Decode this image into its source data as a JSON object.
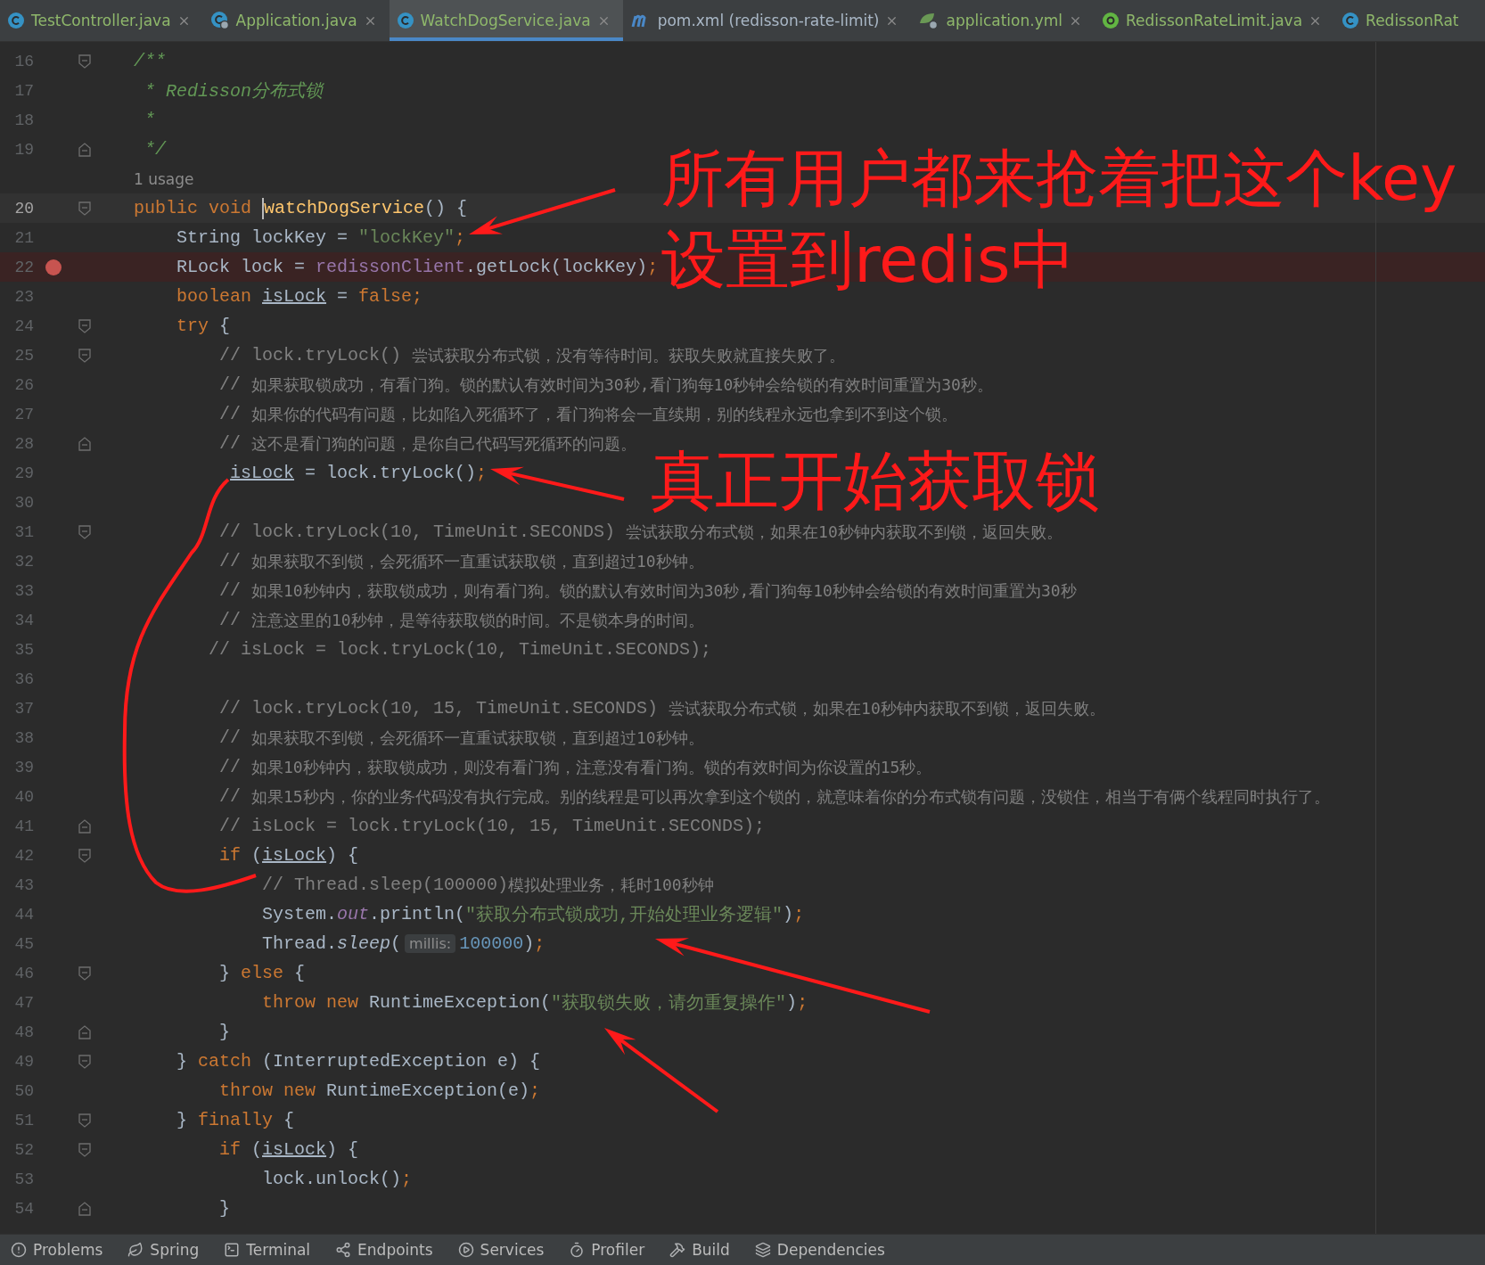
{
  "tabs": [
    {
      "label": "TestController.java",
      "selected": false,
      "color": "#8fb86b",
      "closable": true
    },
    {
      "label": "Application.java",
      "selected": false,
      "color": "#8fb86b",
      "closable": true
    },
    {
      "label": "WatchDogService.java",
      "selected": true,
      "color": "#8fb86b",
      "closable": true
    },
    {
      "label": "pom.xml (redisson-rate-limit)",
      "selected": false,
      "color": "#a9b7c6",
      "closable": true
    },
    {
      "label": "application.yml",
      "selected": false,
      "color": "#8fb86b",
      "closable": true
    },
    {
      "label": "RedissonRateLimit.java",
      "selected": false,
      "color": "#8fb86b",
      "closable": true
    },
    {
      "label": "RedissonRat",
      "selected": false,
      "color": "#8fb86b",
      "closable": false
    }
  ],
  "editor": {
    "lines": [
      {
        "kind": "code",
        "number": "16",
        "fold_start": true,
        "tokens": [
          {
            "kind": "doc",
            "text": "/**"
          }
        ]
      },
      {
        "kind": "code",
        "number": "17",
        "tokens": [
          {
            "kind": "doc",
            "text": " * Redisson分布式锁"
          }
        ]
      },
      {
        "kind": "code",
        "number": "18",
        "tokens": [
          {
            "kind": "doc",
            "text": " *"
          }
        ]
      },
      {
        "kind": "code",
        "number": "19",
        "fold_end": true,
        "tokens": [
          {
            "kind": "doc",
            "text": " */"
          }
        ]
      },
      {
        "kind": "usage",
        "text": "1 usage"
      },
      {
        "kind": "code",
        "number": "20",
        "fold_start": true,
        "current": true,
        "tokens": [
          {
            "kind": "keyword",
            "text": "public void "
          },
          {
            "kind": "method",
            "text": "watchDogService",
            "caret": true
          },
          {
            "kind": "plain",
            "text": "() {"
          }
        ]
      },
      {
        "kind": "code",
        "number": "21",
        "tokens": [
          {
            "kind": "plain",
            "text": "    String lockKey = "
          },
          {
            "kind": "string",
            "text": "\"lockKey\""
          },
          {
            "kind": "keyword",
            "text": ";"
          }
        ]
      },
      {
        "kind": "code",
        "number": "22",
        "breakpoint": true,
        "tokens": [
          {
            "kind": "plain",
            "text": "    RLock lock = "
          },
          {
            "kind": "field",
            "text": "redissonClient"
          },
          {
            "kind": "plain",
            "text": ".getLock(lockKey)"
          },
          {
            "kind": "keyword",
            "text": ";"
          }
        ]
      },
      {
        "kind": "code",
        "number": "23",
        "tokens": [
          {
            "kind": "keyword",
            "text": "    boolean "
          },
          {
            "kind": "var",
            "text": "isLock"
          },
          {
            "kind": "plain",
            "text": " = "
          },
          {
            "kind": "keyword",
            "text": "false;"
          }
        ]
      },
      {
        "kind": "code",
        "number": "24",
        "fold_start": true,
        "tokens": [
          {
            "kind": "keyword",
            "text": "    try "
          },
          {
            "kind": "plain",
            "text": "{"
          }
        ]
      },
      {
        "kind": "code",
        "number": "25",
        "fold_start": true,
        "tokens": [
          {
            "kind": "comment",
            "text": "        // lock.tryLock() "
          },
          {
            "kind": "note",
            "text": "尝试获取分布式锁，没有等待时间。获取失败就直接失败了。"
          }
        ]
      },
      {
        "kind": "code",
        "number": "26",
        "tokens": [
          {
            "kind": "comment",
            "text": "        // "
          },
          {
            "kind": "note",
            "text": "如果获取锁成功，有看门狗。锁的默认有效时间为30秒,看门狗每10秒钟会给锁的有效时间重置为30秒。"
          }
        ]
      },
      {
        "kind": "code",
        "number": "27",
        "tokens": [
          {
            "kind": "comment",
            "text": "        // "
          },
          {
            "kind": "note",
            "text": "如果你的代码有问题，比如陷入死循环了，看门狗将会一直续期，别的线程永远也拿到不到这个锁。"
          }
        ]
      },
      {
        "kind": "code",
        "number": "28",
        "fold_end": true,
        "tokens": [
          {
            "kind": "comment",
            "text": "        // "
          },
          {
            "kind": "note",
            "text": "这不是看门狗的问题，是你自己代码写死循环的问题。"
          }
        ]
      },
      {
        "kind": "code",
        "number": "29",
        "tokens": [
          {
            "kind": "var",
            "text": "         isLock"
          },
          {
            "kind": "plain",
            "text": " = lock.tryLock()"
          },
          {
            "kind": "keyword",
            "text": ";"
          }
        ]
      },
      {
        "kind": "code",
        "number": "30"
      },
      {
        "kind": "code",
        "number": "31",
        "fold_start": true,
        "tokens": [
          {
            "kind": "comment",
            "text": "        // lock.tryLock(10, TimeUnit.SECONDS) "
          },
          {
            "kind": "note",
            "text": "尝试获取分布式锁，如果在10秒钟内获取不到锁，返回失败。"
          }
        ]
      },
      {
        "kind": "code",
        "number": "32",
        "tokens": [
          {
            "kind": "comment",
            "text": "        // "
          },
          {
            "kind": "note",
            "text": "如果获取不到锁，会死循环一直重试获取锁，直到超过10秒钟。"
          }
        ]
      },
      {
        "kind": "code",
        "number": "33",
        "tokens": [
          {
            "kind": "comment",
            "text": "        // "
          },
          {
            "kind": "note",
            "text": "如果10秒钟内，获取锁成功，则有看门狗。锁的默认有效时间为30秒,看门狗每10秒钟会给锁的有效时间重置为30秒"
          }
        ]
      },
      {
        "kind": "code",
        "number": "34",
        "tokens": [
          {
            "kind": "comment",
            "text": "        // "
          },
          {
            "kind": "note",
            "text": "注意这里的10秒钟，是等待获取锁的时间。不是锁本身的时间。"
          }
        ]
      },
      {
        "kind": "code",
        "number": "35",
        "tokens": [
          {
            "kind": "comment",
            "text": "       // isLock = lock.tryLock(10, TimeUnit.SECONDS);"
          }
        ]
      },
      {
        "kind": "code",
        "number": "36"
      },
      {
        "kind": "code",
        "number": "37",
        "tokens": [
          {
            "kind": "comment",
            "text": "        // lock.tryLock(10, 15, TimeUnit.SECONDS) "
          },
          {
            "kind": "note",
            "text": "尝试获取分布式锁，如果在10秒钟内获取不到锁，返回失败。"
          }
        ]
      },
      {
        "kind": "code",
        "number": "38",
        "tokens": [
          {
            "kind": "comment",
            "text": "        // "
          },
          {
            "kind": "note",
            "text": "如果获取不到锁，会死循环一直重试获取锁，直到超过10秒钟。"
          }
        ]
      },
      {
        "kind": "code",
        "number": "39",
        "tokens": [
          {
            "kind": "comment",
            "text": "        // "
          },
          {
            "kind": "note",
            "text": "如果10秒钟内，获取锁成功，则没有看门狗，注意没有看门狗。锁的有效时间为你设置的15秒。"
          }
        ]
      },
      {
        "kind": "code",
        "number": "40",
        "tokens": [
          {
            "kind": "comment",
            "text": "        // "
          },
          {
            "kind": "note",
            "text": "如果15秒内，你的业务代码没有执行完成。别的线程是可以再次拿到这个锁的，就意味着你的分布式锁有问题，没锁住，相当于有俩个线程同时执行了。"
          }
        ]
      },
      {
        "kind": "code",
        "number": "41",
        "fold_end": true,
        "tokens": [
          {
            "kind": "comment",
            "text": "        // isLock = lock.tryLock(10, 15, TimeUnit.SECONDS);"
          }
        ]
      },
      {
        "kind": "code",
        "number": "42",
        "fold_start": true,
        "tokens": [
          {
            "kind": "keyword",
            "text": "        if "
          },
          {
            "kind": "plain",
            "text": "("
          },
          {
            "kind": "var",
            "text": "isLock"
          },
          {
            "kind": "plain",
            "text": ") {"
          }
        ]
      },
      {
        "kind": "code",
        "number": "43",
        "tokens": [
          {
            "kind": "comment",
            "text": "            // Thread.sleep(100000)"
          },
          {
            "kind": "note",
            "text": "模拟处理业务，耗时100秒钟"
          }
        ]
      },
      {
        "kind": "code",
        "number": "44",
        "tokens": [
          {
            "kind": "plain",
            "text": "            System."
          },
          {
            "kind": "static",
            "text": "out"
          },
          {
            "kind": "plain",
            "text": ".println("
          },
          {
            "kind": "string",
            "text": "\"获取分布式锁成功,开始处理业务逻辑\""
          },
          {
            "kind": "plain",
            "text": ")"
          },
          {
            "kind": "keyword",
            "text": ";"
          }
        ]
      },
      {
        "kind": "code",
        "number": "45",
        "tokens": [
          {
            "kind": "plain",
            "text": "            Thread."
          },
          {
            "kind": "italic",
            "text": "sleep"
          },
          {
            "kind": "plain",
            "text": "("
          },
          {
            "kind": "hint",
            "text": "millis:"
          },
          {
            "kind": "number",
            "text": "100000"
          },
          {
            "kind": "plain",
            "text": ")"
          },
          {
            "kind": "keyword",
            "text": ";"
          }
        ]
      },
      {
        "kind": "code",
        "number": "46",
        "fold_start": true,
        "tokens": [
          {
            "kind": "plain",
            "text": "        } "
          },
          {
            "kind": "keyword",
            "text": "else "
          },
          {
            "kind": "plain",
            "text": "{"
          }
        ]
      },
      {
        "kind": "code",
        "number": "47",
        "tokens": [
          {
            "kind": "keyword",
            "text": "            throw new "
          },
          {
            "kind": "plain",
            "text": "RuntimeException("
          },
          {
            "kind": "string",
            "text": "\"获取锁失败，请勿重复操作\""
          },
          {
            "kind": "plain",
            "text": ")"
          },
          {
            "kind": "keyword",
            "text": ";"
          }
        ]
      },
      {
        "kind": "code",
        "number": "48",
        "fold_end": true,
        "tokens": [
          {
            "kind": "plain",
            "text": "        }"
          }
        ]
      },
      {
        "kind": "code",
        "number": "49",
        "fold_start": true,
        "tokens": [
          {
            "kind": "plain",
            "text": "    } "
          },
          {
            "kind": "keyword",
            "text": "catch "
          },
          {
            "kind": "plain",
            "text": "(InterruptedException e) {"
          }
        ]
      },
      {
        "kind": "code",
        "number": "50",
        "tokens": [
          {
            "kind": "keyword",
            "text": "        throw new "
          },
          {
            "kind": "plain",
            "text": "RuntimeException(e)"
          },
          {
            "kind": "keyword",
            "text": ";"
          }
        ]
      },
      {
        "kind": "code",
        "number": "51",
        "fold_start": true,
        "tokens": [
          {
            "kind": "plain",
            "text": "    } "
          },
          {
            "kind": "keyword",
            "text": "finally "
          },
          {
            "kind": "plain",
            "text": "{"
          }
        ]
      },
      {
        "kind": "code",
        "number": "52",
        "fold_start": true,
        "tokens": [
          {
            "kind": "keyword",
            "text": "        if "
          },
          {
            "kind": "plain",
            "text": "("
          },
          {
            "kind": "var",
            "text": "isLock"
          },
          {
            "kind": "plain",
            "text": ") {"
          }
        ]
      },
      {
        "kind": "code",
        "number": "53",
        "tokens": [
          {
            "kind": "plain",
            "text": "            lock.unlock()"
          },
          {
            "kind": "keyword",
            "text": ";"
          }
        ]
      },
      {
        "kind": "code",
        "number": "54",
        "fold_end": true,
        "tokens": [
          {
            "kind": "plain",
            "text": "        }"
          }
        ]
      }
    ]
  },
  "annotations": [
    {
      "text": "所有用户都来抢着把这个key"
    },
    {
      "text": "设置到redis中"
    },
    {
      "text": "真正开始获取锁"
    }
  ],
  "tool_windows": [
    {
      "label": "Problems"
    },
    {
      "label": "Spring"
    },
    {
      "label": "Terminal"
    },
    {
      "label": "Endpoints"
    },
    {
      "label": "Services"
    },
    {
      "label": "Profiler"
    },
    {
      "label": "Build"
    },
    {
      "label": "Dependencies"
    }
  ]
}
